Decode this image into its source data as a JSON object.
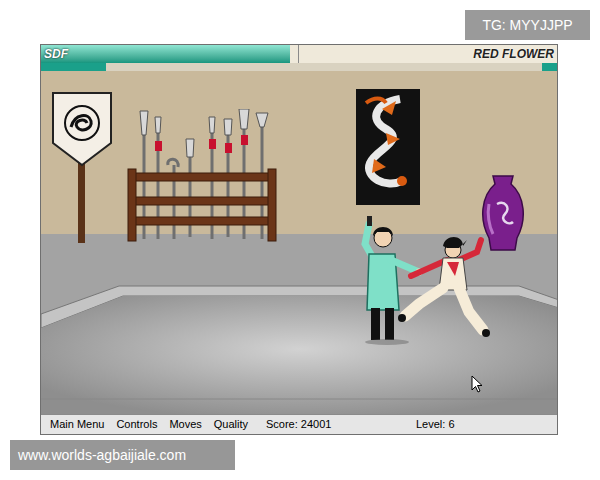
{
  "overlays": {
    "top_right": "TG: MYYJJPP",
    "bottom_left": "www.worlds-agbaijiale.com"
  },
  "players": [
    {
      "name": "SDF",
      "health": 0.97,
      "stamina": 0.25
    },
    {
      "name": "RED FLOWER",
      "health": 0.0,
      "stamina": 0.06
    }
  ],
  "menu": [
    {
      "label": "Main Menu"
    },
    {
      "label": "Controls"
    },
    {
      "label": "Moves"
    },
    {
      "label": "Quality"
    }
  ],
  "score": "Score: 24001",
  "level": "Level: 6"
}
